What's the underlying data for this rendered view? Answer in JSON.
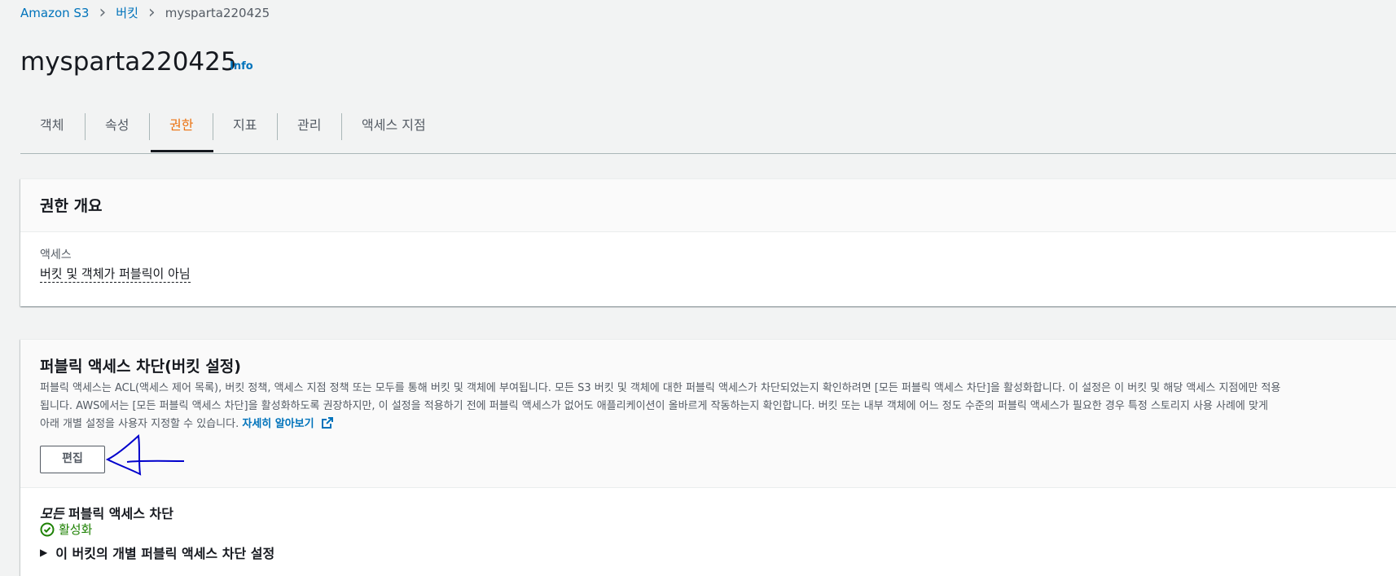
{
  "breadcrumb": {
    "items": [
      "Amazon S3",
      "버킷",
      "mysparta220425"
    ],
    "separator": ">"
  },
  "page": {
    "title": "mysparta220425",
    "info_link": "Info"
  },
  "tabs": [
    "객체",
    "속성",
    "권한",
    "지표",
    "관리",
    "액세스 지점"
  ],
  "active_tab": "권한",
  "overview": {
    "heading": "권한 개요",
    "access_label": "액세스",
    "access_value": "버킷 및 객체가 퍼블릭이 아님"
  },
  "block_public": {
    "heading": "퍼블릭 액세스 차단(버킷 설정)",
    "desc_line1": "퍼블릭 액세스는 ACL(액세스 제어 목록), 버킷 정책, 액세스 지점 정책 또는 모두를 통해 버킷 및 객체에 부여됩니다. 모든 S3 버킷 및 객체에 대한 퍼블릭 액세스가 차단되었는지 확인하려면 [모든 퍼블릭 액세스 차단]을 활성화합니다. 이 설정은 이 버킷 및 해당 액세스 지점에만 적용",
    "desc_line2": "됩니다. AWS에서는 [모든 퍼블릭 액세스 차단]을 활성화하도록 권장하지만, 이 설정을 적용하기 전에 퍼블릭 액세스가 없어도 애플리케이션이 올바르게 작동하는지 확인합니다. 버킷 또는 내부 객체에 어느 정도 수준의 퍼블릭 액세스가 필요한 경우 특정 스토리지 사용 사례에 맞게",
    "desc_line3": "아래 개별 설정을 사용자 지정할 수 있습니다.",
    "learn_more": "자세히 알아보기",
    "edit_button": "편집",
    "all_block_label_italic": "모든",
    "all_block_label_rest": " 퍼블릭 액세스 차단",
    "status": "활성화",
    "expand_label": "이 버킷의 개별 퍼블릭 액세스 차단 설정"
  },
  "colors": {
    "link": "#0073bb",
    "active_tab": "#ec7211",
    "success": "#1d8102",
    "annotation": "#0000cc"
  },
  "icons": [
    "chevron-right-icon",
    "external-link-icon",
    "check-circle-icon",
    "caret-right-icon",
    "hand-drawn-arrow-annotation"
  ]
}
